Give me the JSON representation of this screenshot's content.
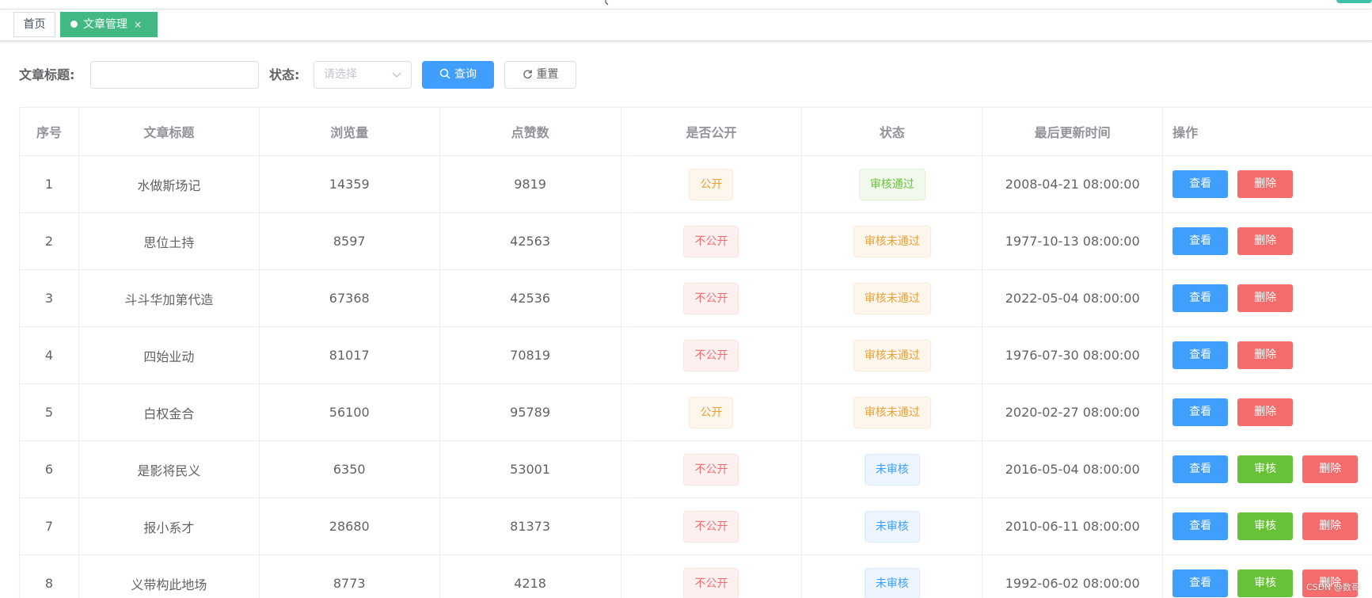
{
  "tabs": {
    "home": "首页",
    "active": "文章管理",
    "close": "×"
  },
  "search": {
    "title_label": "文章标题:",
    "title_value": "",
    "status_label": "状态:",
    "status_placeholder": "请选择",
    "query_button": "查询",
    "reset_button": "重置"
  },
  "table": {
    "headers": [
      "序号",
      "文章标题",
      "浏览量",
      "点赞数",
      "是否公开",
      "状态",
      "最后更新时间",
      "操作"
    ],
    "rows": [
      {
        "index": "1",
        "title": "水做斯场记",
        "views": "14359",
        "likes": "9819",
        "public": "公开",
        "public_type": "warning",
        "status": "审核通过",
        "status_type": "success",
        "updated": "2008-04-21 08:00:00",
        "actions": [
          "查看",
          "删除"
        ]
      },
      {
        "index": "2",
        "title": "思位土持",
        "views": "8597",
        "likes": "42563",
        "public": "不公开",
        "public_type": "danger",
        "status": "审核未通过",
        "status_type": "warning",
        "updated": "1977-10-13 08:00:00",
        "actions": [
          "查看",
          "删除"
        ]
      },
      {
        "index": "3",
        "title": "斗斗华加第代造",
        "views": "67368",
        "likes": "42536",
        "public": "不公开",
        "public_type": "danger",
        "status": "审核未通过",
        "status_type": "warning",
        "updated": "2022-05-04 08:00:00",
        "actions": [
          "查看",
          "删除"
        ]
      },
      {
        "index": "4",
        "title": "四始业动",
        "views": "81017",
        "likes": "70819",
        "public": "不公开",
        "public_type": "danger",
        "status": "审核未通过",
        "status_type": "warning",
        "updated": "1976-07-30 08:00:00",
        "actions": [
          "查看",
          "删除"
        ]
      },
      {
        "index": "5",
        "title": "白权金合",
        "views": "56100",
        "likes": "95789",
        "public": "公开",
        "public_type": "warning",
        "status": "审核未通过",
        "status_type": "warning",
        "updated": "2020-02-27 08:00:00",
        "actions": [
          "查看",
          "删除"
        ]
      },
      {
        "index": "6",
        "title": "是影将民义",
        "views": "6350",
        "likes": "53001",
        "public": "不公开",
        "public_type": "danger",
        "status": "未审核",
        "status_type": "info",
        "updated": "2016-05-04 08:00:00",
        "actions": [
          "查看",
          "审核",
          "删除"
        ]
      },
      {
        "index": "7",
        "title": "报小系才",
        "views": "28680",
        "likes": "81373",
        "public": "不公开",
        "public_type": "danger",
        "status": "未审核",
        "status_type": "info",
        "updated": "2010-06-11 08:00:00",
        "actions": [
          "查看",
          "审核",
          "删除"
        ]
      },
      {
        "index": "8",
        "title": "义带构此地场",
        "views": "8773",
        "likes": "4218",
        "public": "不公开",
        "public_type": "danger",
        "status": "未审核",
        "status_type": "info",
        "updated": "1992-06-02 08:00:00",
        "actions": [
          "查看",
          "审核",
          "删除"
        ]
      }
    ]
  },
  "watermark": "CSDN @数哥",
  "colors": {
    "primary": "#409eff",
    "success": "#67c23a",
    "danger": "#f56c6c",
    "warning": "#e6a23c",
    "active_tab": "#42b983"
  }
}
